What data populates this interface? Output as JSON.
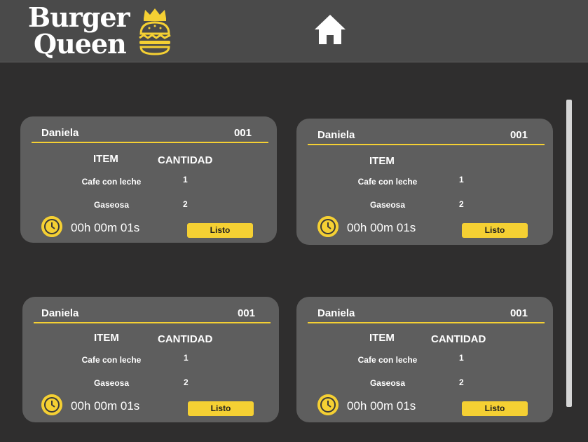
{
  "app": {
    "logo_line1": "Burger",
    "logo_line2": "Queen",
    "accent_color": "#f5d033",
    "home_icon": "home-icon"
  },
  "orders": [
    {
      "customer": "Daniela",
      "number": "001",
      "header_item": "ITEM",
      "header_qty": "CANTIDAD",
      "items": [
        {
          "name": "Cafe con leche",
          "qty": "1"
        },
        {
          "name": "Gaseosa",
          "qty": "2"
        }
      ],
      "timer": "00h 00m 01s",
      "ready_label": "Listo"
    },
    {
      "customer": "Daniela",
      "number": "001",
      "header_item": "ITEM",
      "header_qty": "",
      "items": [
        {
          "name": "Cafe con leche",
          "qty": "1"
        },
        {
          "name": "Gaseosa",
          "qty": "2"
        }
      ],
      "timer": "00h 00m 01s",
      "ready_label": "Listo"
    },
    {
      "customer": "Daniela",
      "number": "001",
      "header_item": "ITEM",
      "header_qty": "CANTIDAD",
      "items": [
        {
          "name": "Cafe con leche",
          "qty": "1"
        },
        {
          "name": "Gaseosa",
          "qty": "2"
        }
      ],
      "timer": "00h 00m 01s",
      "ready_label": "Listo"
    },
    {
      "customer": "Daniela",
      "number": "001",
      "header_item": "ITEM",
      "header_qty": "CANTIDAD",
      "items": [
        {
          "name": "Cafe con leche",
          "qty": "1"
        },
        {
          "name": "Gaseosa",
          "qty": "2"
        }
      ],
      "timer": "00h 00m 01s",
      "ready_label": "Listo"
    }
  ]
}
